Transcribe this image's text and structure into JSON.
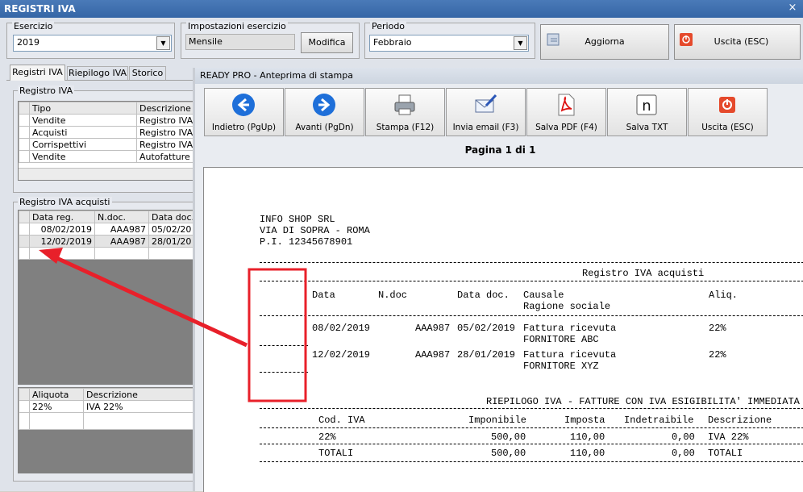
{
  "main_window": {
    "title": "REGISTRI IVA",
    "close_glyph": "×",
    "esercizio": {
      "label": "Esercizio",
      "value": "2019"
    },
    "impostazioni": {
      "label": "Impostazioni esercizio",
      "value": "Mensile",
      "button": "Modifica"
    },
    "periodo": {
      "label": "Periodo",
      "value": "Febbraio"
    },
    "aggiorna_button": "Aggiorna",
    "uscita_button": "Uscita (ESC)",
    "tabs": [
      "Registri IVA",
      "Riepilogo IVA",
      "Storico"
    ],
    "registro_iva": {
      "label": "Registro IVA",
      "headers": [
        "Tipo",
        "Descrizione re"
      ],
      "rows": [
        [
          "Vendite",
          "Registro IVA v"
        ],
        [
          "Acquisti",
          "Registro IVA a"
        ],
        [
          "Corrispettivi",
          "Registro IVA c"
        ],
        [
          "Vendite",
          "Autofatture re"
        ]
      ]
    },
    "registro_acquisti": {
      "label": "Registro IVA acquisti",
      "headers": [
        "Data reg.",
        "N.doc.",
        "Data doc."
      ],
      "rows": [
        [
          "08/02/2019",
          "AAA987",
          "05/02/20"
        ],
        [
          "12/02/2019",
          "AAA987",
          "28/01/20"
        ]
      ]
    },
    "aliquote": {
      "headers": [
        "Aliquota",
        "Descrizione"
      ],
      "rows": [
        [
          "22%",
          "IVA 22%"
        ]
      ]
    }
  },
  "preview_window": {
    "title": "READY PRO - Anteprima di stampa",
    "toolbar": [
      {
        "label": "Indietro (PgUp)",
        "icon": "arrow-left-icon"
      },
      {
        "label": "Avanti (PgDn)",
        "icon": "arrow-right-icon"
      },
      {
        "label": "Stampa (F12)",
        "icon": "printer-icon"
      },
      {
        "label": "Invia email (F3)",
        "icon": "email-icon"
      },
      {
        "label": "Salva PDF (F4)",
        "icon": "pdf-icon"
      },
      {
        "label": "Salva TXT",
        "icon": "txt-icon"
      },
      {
        "label": "Uscita (ESC)",
        "icon": "exit-icon"
      }
    ],
    "page_indicator": "Pagina 1 di 1",
    "report": {
      "company": [
        "INFO SHOP SRL",
        "VIA DI SOPRA - ROMA",
        "P.I. 12345678901"
      ],
      "register_title": "Registro IVA acquisti",
      "columns": [
        "Data",
        "N.doc",
        "Data doc.",
        "Causale",
        "Ragione sociale",
        "Aliq."
      ],
      "entries": [
        {
          "data": "08/02/2019",
          "ndoc": "AAA987",
          "data_doc": "05/02/2019",
          "causale": "Fattura ricevuta",
          "ragione": "FORNITORE ABC",
          "aliq": "22%"
        },
        {
          "data": "12/02/2019",
          "ndoc": "AAA987",
          "data_doc": "28/01/2019",
          "causale": "Fattura ricevuta",
          "ragione": "FORNITORE XYZ",
          "aliq": "22%"
        }
      ],
      "summary_title": "RIEPILOGO IVA - FATTURE CON IVA ESIGIBILITA' IMMEDIATA",
      "summary_headers": [
        "Cod. IVA",
        "Imponibile",
        "Imposta",
        "Indetraibile",
        "Descrizione"
      ],
      "summary_rows": [
        [
          "22%",
          "500,00",
          "110,00",
          "0,00",
          "IVA 22%"
        ],
        [
          "TOTALI",
          "500,00",
          "110,00",
          "0,00",
          "TOTALI"
        ]
      ]
    }
  },
  "colors": {
    "title_bar": "#3a6fb0",
    "annotation": "#e8202a"
  }
}
